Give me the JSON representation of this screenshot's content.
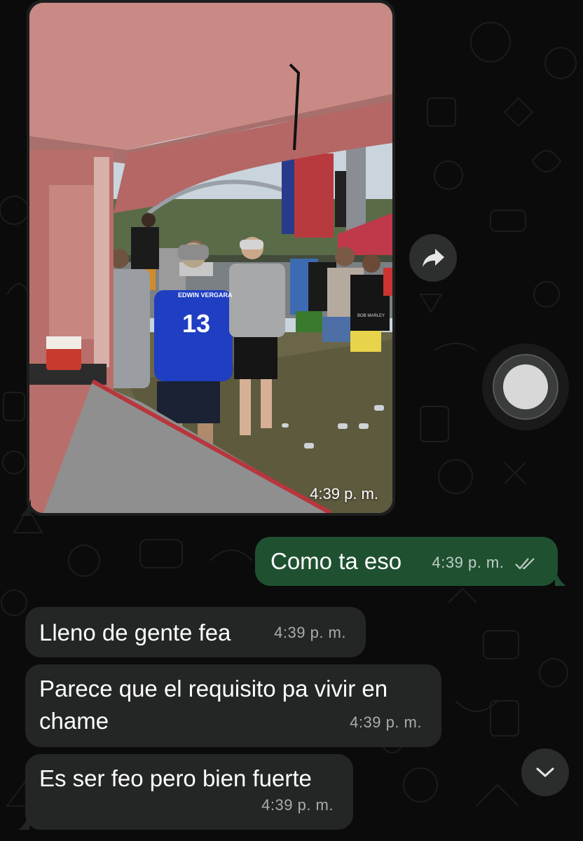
{
  "colors": {
    "background": "#0b0b0b",
    "incoming_bubble": "#242626",
    "outgoing_bubble": "#1f5131",
    "timestamp": "#a8acae"
  },
  "image_message": {
    "time": "4:39 p. m.",
    "photo": {
      "jersey_brand": "EDWIN VERGARA",
      "jersey_number": "13",
      "shirt_print": "BOB MARLEY"
    }
  },
  "messages": [
    {
      "direction": "outgoing",
      "text": "Como ta eso",
      "time": "4:39 p. m.",
      "status_icon": "double-check-icon"
    },
    {
      "direction": "incoming",
      "text": "Lleno de gente fea",
      "time": "4:39 p. m."
    },
    {
      "direction": "incoming",
      "text": "Parece que el requisito pa vivir en chame",
      "time": "4:39 p. m."
    },
    {
      "direction": "incoming",
      "text": "Es ser feo pero bien fuerte",
      "time": "4:39 p. m."
    }
  ],
  "controls": {
    "forward_icon": "forward-arrow-icon",
    "record_icon": "video-record-icon",
    "scroll_icon": "chevron-down-icon"
  }
}
